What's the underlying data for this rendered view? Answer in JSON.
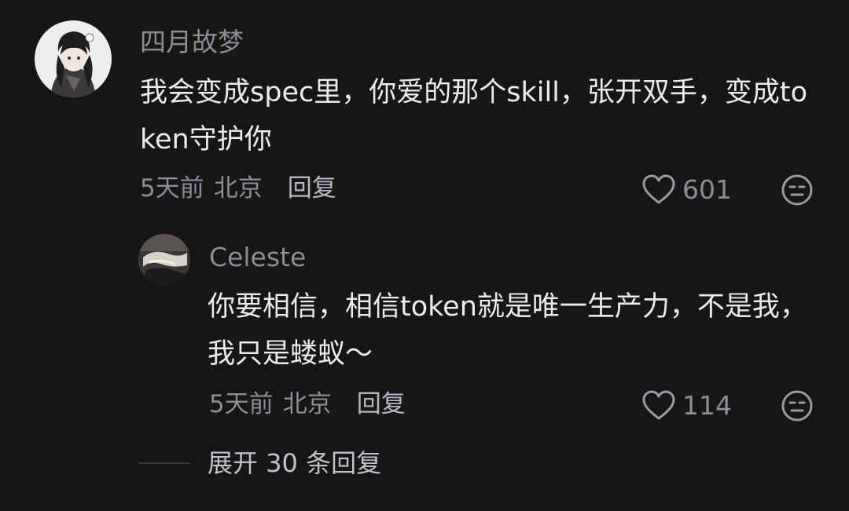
{
  "comments": [
    {
      "username": "四月故梦",
      "content": "我会变成spec里，你爱的那个skill，张开双手，变成token守护你",
      "time": "5天前",
      "location": "北京",
      "reply_label": "回复",
      "likes": "601"
    }
  ],
  "reply": {
    "username": "Celeste",
    "content": "你要相信，相信token就是唯一生产力，不是我，我只是蝼蚁～",
    "time": "5天前",
    "location": "北京",
    "reply_label": "回复",
    "likes": "114"
  },
  "expand_label": "展开 30 条回复",
  "icons": {
    "like": "heart-icon",
    "dislike": "neutral-face-icon"
  },
  "colors": {
    "background": "#161618",
    "text": "#ececef",
    "muted": "#8d8d92"
  }
}
